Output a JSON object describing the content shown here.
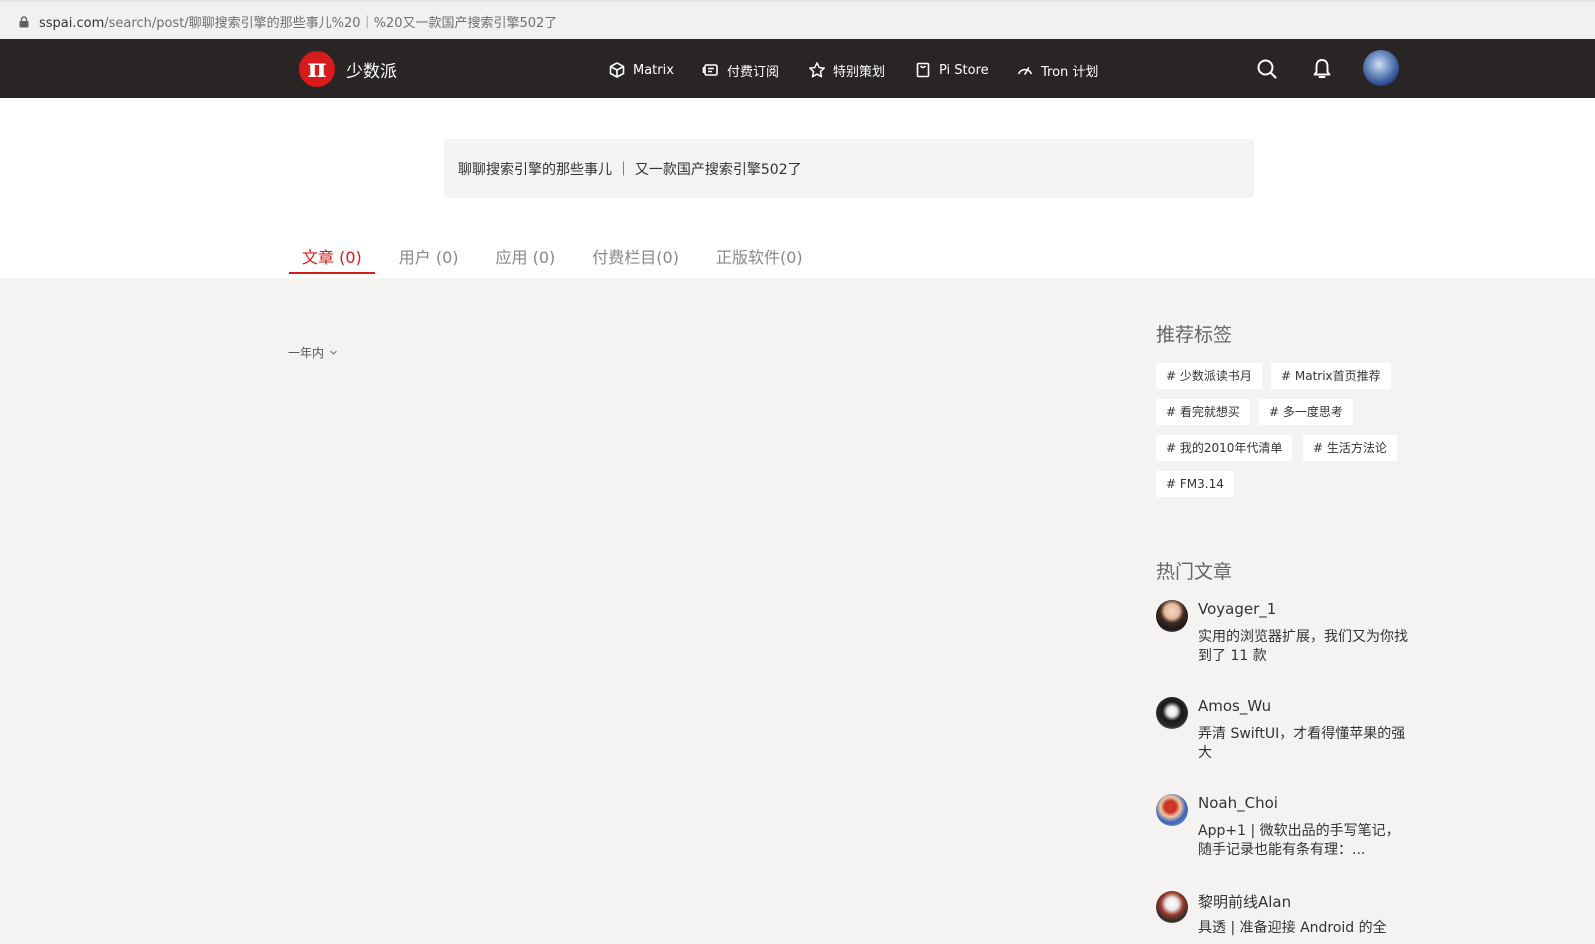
{
  "browser": {
    "url_domain": "sspai.com",
    "url_path": "/search/post/聊聊搜索引擎的那些事儿%20｜%20又一款国产搜索引擎502了"
  },
  "nav": {
    "logo_text": "少数派",
    "items": [
      {
        "label": "Matrix",
        "icon": "cube-icon"
      },
      {
        "label": "付费订阅",
        "icon": "subscription-icon"
      },
      {
        "label": "特别策划",
        "icon": "star-icon"
      },
      {
        "label": "Pi Store",
        "icon": "bag-icon"
      },
      {
        "label": "Tron 计划",
        "icon": "gauge-icon"
      }
    ]
  },
  "search": {
    "query": "聊聊搜索引擎的那些事儿 ｜ 又一款国产搜索引擎502了"
  },
  "tabs": [
    {
      "label": "文章 (0)",
      "active": true
    },
    {
      "label": "用户 (0)",
      "active": false
    },
    {
      "label": "应用 (0)",
      "active": false
    },
    {
      "label": "付费栏目(0)",
      "active": false
    },
    {
      "label": "正版软件(0)",
      "active": false
    }
  ],
  "filter": {
    "selected": "一年内"
  },
  "sidebar": {
    "tags_title": "推荐标签",
    "tags": [
      "# 少数派读书月",
      "# Matrix首页推荐",
      "# 看完就想买",
      "# 多一度思考",
      "# 我的2010年代清单",
      "# 生活方法论",
      "# FM3.14"
    ],
    "hot_title": "热门文章",
    "articles": [
      {
        "author": "Voyager_1",
        "title": "实用的浏览器扩展，我们又为你找到了 11 款"
      },
      {
        "author": "Amos_Wu",
        "title": "弄清 SwiftUI，才看得懂苹果的强大"
      },
      {
        "author": "Noah_Choi",
        "title": "App+1 | 微软出品的手写笔记，随手记录也能有条有理：..."
      },
      {
        "author": "黎明前线Alan",
        "title": "具透 | 准备迎接 Android 的全"
      }
    ]
  },
  "colors": {
    "brand_red": "#d71a1b",
    "nav_bg": "#292525",
    "page_bg": "#f4f3f2"
  }
}
